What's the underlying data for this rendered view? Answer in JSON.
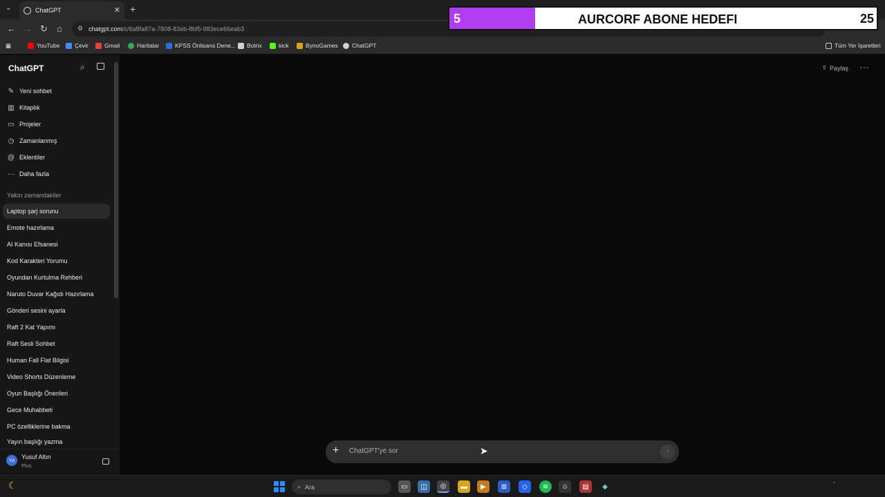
{
  "browser": {
    "tab_title": "ChatGPT",
    "url_main": "chatgpt.com",
    "url_path": "/c/6a8fa87a-7808-83eb-8bf5-983ece66eab3",
    "bookmarks": [
      "YouTube",
      "Çevir",
      "Gmail",
      "Haritalar",
      "KPSS Önlisans Dene...",
      "Botrix",
      "kick",
      "BynoGames",
      "ChatGPT"
    ],
    "all_bookmarks": "Tüm Yer İşaretleri"
  },
  "overlay": {
    "current": "5",
    "title": "AURCORF ABONE HEDEFI",
    "goal": "25",
    "fill_fraction": 0.2,
    "fill_color": "#b03df0"
  },
  "sidebar": {
    "brand": "ChatGPT",
    "menu": [
      {
        "label": "Yeni sohbet",
        "icon": "new-chat-icon"
      },
      {
        "label": "Kitaplık",
        "icon": "library-icon"
      },
      {
        "label": "Projeler",
        "icon": "folder-icon"
      },
      {
        "label": "Zamanlanmış",
        "icon": "clock-icon"
      },
      {
        "label": "Eklentiler",
        "icon": "at-icon"
      },
      {
        "label": "Daha fazla",
        "icon": "more-dots-icon"
      }
    ],
    "recent_title": "Yakın zamandakiler",
    "chats": [
      "Laptop şarj sorunu",
      "Emote hazırlama",
      "AI Kanısı Efsanesi",
      "Kod Karakteri Yorumu",
      "Oyundan Kurtulma Rehberi",
      "Naruto Duvar Kağıdı Hazırlama",
      "Gönderi sesini ayarla",
      "Raft 2 Kat Yapımı",
      "Raft Sesli Sohbet",
      "Human Fall Flat Bilgisi",
      "Video Shorts Düzenleme",
      "Oyun Başlığı Önerileri",
      "Gece Muhabbeti",
      "PC özelliklerine bakma",
      "Yayın başlığı yazma"
    ],
    "user": {
      "initials": "YA",
      "name": "Yusuf Altın",
      "plan": "Plus"
    }
  },
  "main": {
    "share": "Paylaş",
    "composer_placeholder": "ChatGPT'ye sor"
  },
  "taskbar": {
    "search": "Ara"
  }
}
